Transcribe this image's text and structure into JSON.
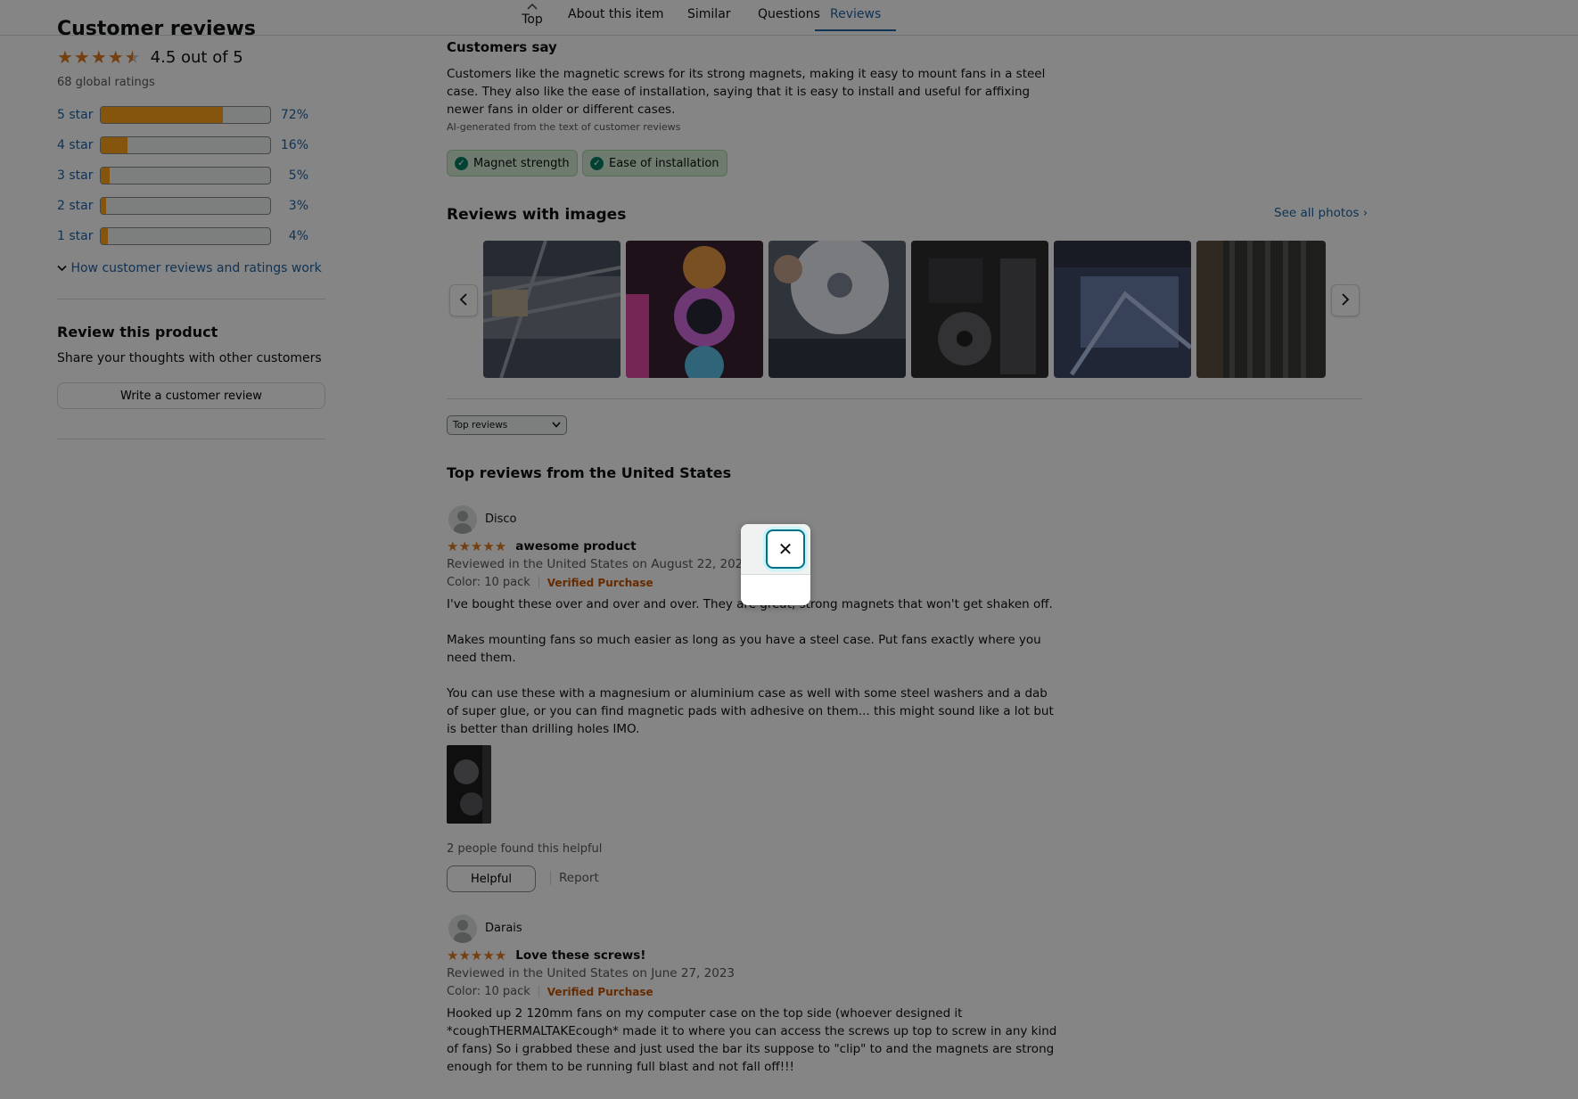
{
  "nav": {
    "top_label": "Top",
    "links": [
      "About this item",
      "Similar",
      "Questions",
      "Reviews"
    ]
  },
  "summary": {
    "title": "Customer reviews",
    "rating_text": "4.5 out of 5",
    "global_ratings": "68 global ratings",
    "histogram": [
      {
        "label": "5 star",
        "percent": "72%",
        "value": 72
      },
      {
        "label": "4 star",
        "percent": "16%",
        "value": 16
      },
      {
        "label": "3 star",
        "percent": "5%",
        "value": 5
      },
      {
        "label": "2 star",
        "percent": "3%",
        "value": 3
      },
      {
        "label": "1 star",
        "percent": "4%",
        "value": 4
      }
    ],
    "how_link": "How customer reviews and ratings work"
  },
  "review_product": {
    "title": "Review this product",
    "subtitle": "Share your thoughts with other customers",
    "button": "Write a customer review"
  },
  "customers_say": {
    "title": "Customers say",
    "body": "Customers like the magnetic screws for its strong magnets, making it easy to mount fans in a steel case. They also like the ease of installation, saying that it is easy to install and useful for affixing newer fans in older or different cases.",
    "ai_note": "AI-generated from the text of customer reviews",
    "chips": [
      "Magnet strength",
      "Ease of installation"
    ]
  },
  "reviews_with_images": {
    "title": "Reviews with images",
    "see_all": "See all photos ›"
  },
  "sort": {
    "selected": "Top reviews"
  },
  "top_reviews_title": "Top reviews from the United States",
  "reviews": [
    {
      "name": "Disco",
      "stars": "★★★★★",
      "headline": "awesome product",
      "date": "Reviewed in the United States on August 22, 2023",
      "color": "Color: 10 pack",
      "verified": "Verified Purchase",
      "paragraphs": [
        "I've bought these over and over and over. They are great, strong magnets that won't get shaken off.",
        "Makes mounting fans so much easier as long as you have a steel case. Put fans exactly where you need them.",
        "You can use these with a magnesium or aluminium case as well with some steel washers and a dab of super glue, or you can find magnetic pads with adhesive on them... this might sound like a lot but is better than drilling holes IMO."
      ],
      "helpful_text": "2 people found this helpful",
      "helpful_button": "Helpful",
      "report": "Report"
    },
    {
      "name": "Darais",
      "stars": "★★★★★",
      "headline": "Love these screws!",
      "date": "Reviewed in the United States on June 27, 2023",
      "color": "Color: 10 pack",
      "verified": "Verified Purchase",
      "paragraphs": [
        "Hooked up 2 120mm fans on my computer case on the top side (whoever designed it *coughTHERMALTAKEcough* made it to where you can access the screws up top to screw in any kind of fans) So i grabbed these and just used the bar its suppose to \"clip\" to and the magnets are strong enough for them to be running full blast and not fall off!!!"
      ]
    }
  ],
  "modal": {
    "close_symbol": "✕"
  }
}
